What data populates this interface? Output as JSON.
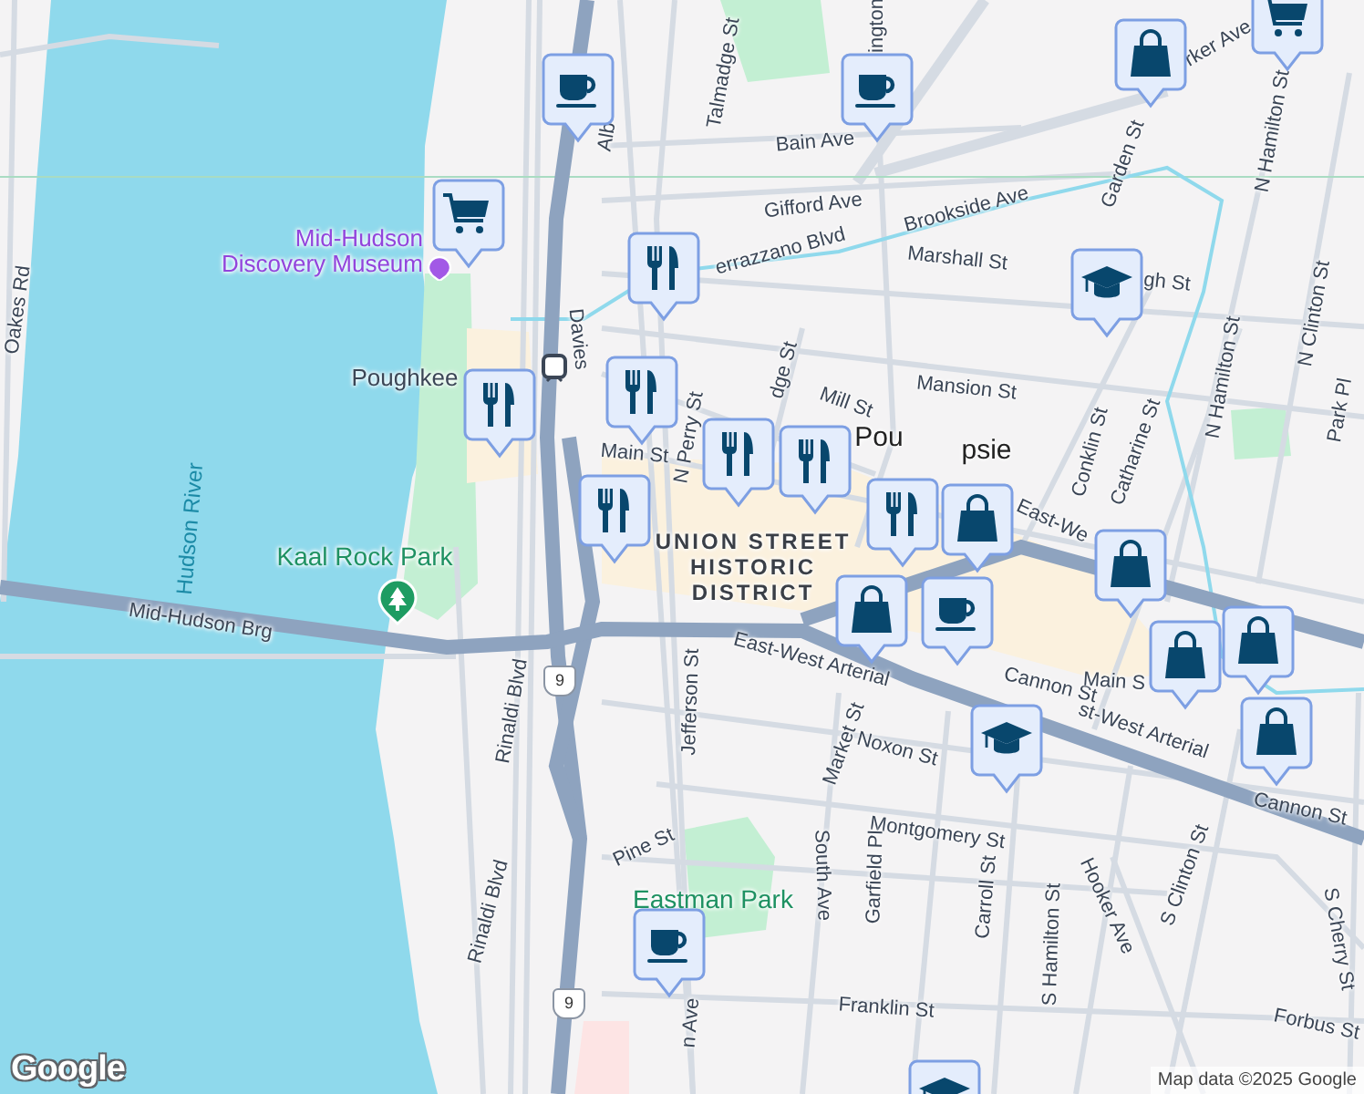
{
  "map": {
    "labels": [
      {
        "text": "Oakes Rd",
        "kind": "street"
      },
      {
        "text": "Hudson River",
        "kind": "water"
      },
      {
        "text": "Mid-Hudson Discovery Museum",
        "kind": "museum"
      },
      {
        "text": "Poughkee",
        "kind": "station"
      },
      {
        "text": "Kaal Rock Park",
        "kind": "park"
      },
      {
        "text": "Mid-Hudson Brg",
        "kind": "street"
      },
      {
        "text": "Rinaldi Blvd",
        "kind": "street"
      },
      {
        "text": "Rinaldi Blvd",
        "kind": "street"
      },
      {
        "text": "Pine St",
        "kind": "street"
      },
      {
        "text": "Eastman Park",
        "kind": "park"
      },
      {
        "text": "Alb",
        "kind": "street"
      },
      {
        "text": "Talmadge St",
        "kind": "street"
      },
      {
        "text": "ington",
        "kind": "street"
      },
      {
        "text": "Bain Ave",
        "kind": "street"
      },
      {
        "text": "Gifford Ave",
        "kind": "street"
      },
      {
        "text": "Brookside Ave",
        "kind": "street"
      },
      {
        "text": "errazzano Blvd",
        "kind": "street"
      },
      {
        "text": "Marshall St",
        "kind": "street"
      },
      {
        "text": "gh St",
        "kind": "street"
      },
      {
        "text": "rker Ave",
        "kind": "street"
      },
      {
        "text": "Garden St",
        "kind": "street"
      },
      {
        "text": "N Hamilton St",
        "kind": "street"
      },
      {
        "text": "N Hamilton St",
        "kind": "street"
      },
      {
        "text": "N Clinton St",
        "kind": "street"
      },
      {
        "text": "Park Pl",
        "kind": "street"
      },
      {
        "text": "Mansion St",
        "kind": "street"
      },
      {
        "text": "Mill St",
        "kind": "street"
      },
      {
        "text": "dge St",
        "kind": "street"
      },
      {
        "text": "N Perry St",
        "kind": "street"
      },
      {
        "text": "Davies",
        "kind": "street"
      },
      {
        "text": "Main St",
        "kind": "street"
      },
      {
        "text": "Conklin St",
        "kind": "street"
      },
      {
        "text": "Catharine St",
        "kind": "street"
      },
      {
        "text": "Pou",
        "kind": "city"
      },
      {
        "text": "psie",
        "kind": "city"
      },
      {
        "text": "UNION STREET HISTORIC DISTRICT",
        "kind": "district"
      },
      {
        "text": "East-We",
        "kind": "street"
      },
      {
        "text": "East-West Arterial",
        "kind": "street"
      },
      {
        "text": "st-West Arterial",
        "kind": "street"
      },
      {
        "text": "Cannon St",
        "kind": "street"
      },
      {
        "text": "Cannon St",
        "kind": "street"
      },
      {
        "text": "Noxon St",
        "kind": "street"
      },
      {
        "text": "Market St",
        "kind": "street"
      },
      {
        "text": "Jefferson St",
        "kind": "street"
      },
      {
        "text": "Montgomery St",
        "kind": "street"
      },
      {
        "text": "South Ave",
        "kind": "street"
      },
      {
        "text": "Garfield Pl",
        "kind": "street"
      },
      {
        "text": "Carroll St",
        "kind": "street"
      },
      {
        "text": "S Hamilton St",
        "kind": "street"
      },
      {
        "text": "Hooker Ave",
        "kind": "street"
      },
      {
        "text": "S Clinton St",
        "kind": "street"
      },
      {
        "text": "S Cherry St",
        "kind": "street"
      },
      {
        "text": "Franklin St",
        "kind": "street"
      },
      {
        "text": "Forbus St",
        "kind": "street"
      },
      {
        "text": "Main S",
        "kind": "street"
      },
      {
        "text": "n Ave",
        "kind": "street"
      }
    ],
    "route_shields": [
      {
        "text": "9"
      },
      {
        "text": "9"
      }
    ],
    "pins": [
      {
        "kind": "cafe"
      },
      {
        "kind": "grocery"
      },
      {
        "kind": "restaurant"
      },
      {
        "kind": "restaurant"
      },
      {
        "kind": "restaurant"
      },
      {
        "kind": "restaurant"
      },
      {
        "kind": "restaurant"
      },
      {
        "kind": "restaurant"
      },
      {
        "kind": "restaurant"
      },
      {
        "kind": "shopping"
      },
      {
        "kind": "shopping"
      },
      {
        "kind": "cafe"
      },
      {
        "kind": "shopping"
      },
      {
        "kind": "shopping"
      },
      {
        "kind": "shopping"
      },
      {
        "kind": "shopping"
      },
      {
        "kind": "school"
      },
      {
        "kind": "school"
      },
      {
        "kind": "school"
      },
      {
        "kind": "cafe"
      },
      {
        "kind": "shopping"
      },
      {
        "kind": "grocery"
      },
      {
        "kind": "cafe"
      }
    ]
  },
  "logo": "Google",
  "attribution": "Map data ©2025 Google"
}
